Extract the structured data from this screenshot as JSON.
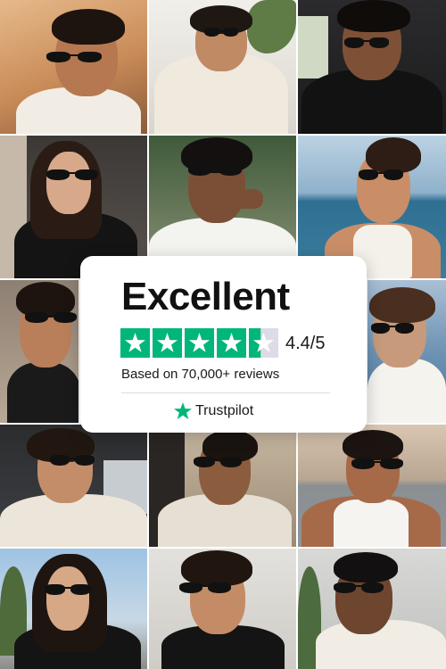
{
  "review_card": {
    "headline": "Excellent",
    "rating_text": "4.4/5",
    "rating_value": 4.4,
    "rating_max": 5,
    "reviews_text": "Based on 70,000+ reviews",
    "brand_name": "Trustpilot",
    "brand_icon": "trustpilot-star-icon",
    "star_color": "#00b67a",
    "empty_star_color": "#dcdce6"
  },
  "gallery": {
    "photo_count": 15,
    "subject": "people wearing black sunglasses"
  }
}
